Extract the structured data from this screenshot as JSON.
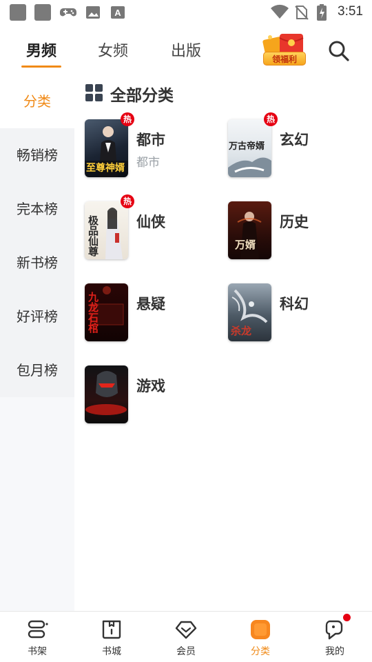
{
  "status_bar": {
    "time": "3:51",
    "icons": [
      "app-icon",
      "app-icon",
      "gamepad-icon",
      "image-icon",
      "font-icon",
      "wifi-icon",
      "no-sim-icon",
      "battery-charging-icon"
    ]
  },
  "top_tabs": {
    "items": [
      {
        "label": "男频",
        "active": true
      },
      {
        "label": "女频",
        "active": false
      },
      {
        "label": "出版",
        "active": false
      }
    ],
    "gift_label": "领福利",
    "search_icon": "search-icon",
    "accent_color": "#f08a17"
  },
  "sidebar": {
    "items": [
      {
        "label": "分类",
        "active": true
      },
      {
        "label": "畅销榜",
        "active": false
      },
      {
        "label": "完本榜",
        "active": false
      },
      {
        "label": "新书榜",
        "active": false
      },
      {
        "label": "好评榜",
        "active": false
      },
      {
        "label": "包月榜",
        "active": false
      }
    ]
  },
  "main": {
    "section_title": "全部分类",
    "section_icon": "grid-icon",
    "hot_badge": "热",
    "categories": [
      {
        "name": "都市",
        "subtitle": "都市",
        "hot": true,
        "cover_text": "至尊神婿"
      },
      {
        "name": "玄幻",
        "subtitle": "",
        "hot": true,
        "cover_text": "万古帝婿"
      },
      {
        "name": "仙侠",
        "subtitle": "",
        "hot": true,
        "cover_text": "极品仙尊"
      },
      {
        "name": "历史",
        "subtitle": "",
        "hot": false,
        "cover_text": "万婿"
      },
      {
        "name": "悬疑",
        "subtitle": "",
        "hot": false,
        "cover_text": "九龙石棺"
      },
      {
        "name": "科幻",
        "subtitle": "",
        "hot": false,
        "cover_text": "杀龙"
      },
      {
        "name": "游戏",
        "subtitle": "",
        "hot": false,
        "cover_text": ""
      }
    ]
  },
  "bottom_nav": {
    "items": [
      {
        "label": "书架",
        "icon": "bookshelf-icon",
        "active": false
      },
      {
        "label": "书城",
        "icon": "book-store-icon",
        "active": false
      },
      {
        "label": "会员",
        "icon": "diamond-icon",
        "active": false
      },
      {
        "label": "分类",
        "icon": "category-icon",
        "active": true
      },
      {
        "label": "我的",
        "icon": "profile-icon",
        "active": false,
        "notification_dot": true
      }
    ]
  }
}
